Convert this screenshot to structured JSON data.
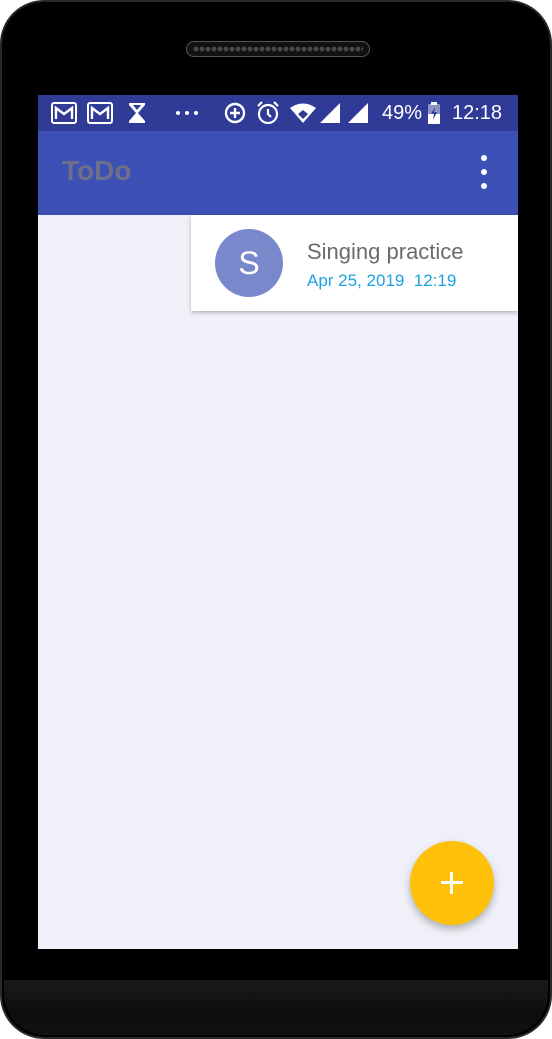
{
  "status_bar": {
    "icons": [
      "gmail-icon",
      "gmail-icon",
      "hourglass-icon",
      "more-notifications-icon",
      "data-saver-icon",
      "alarm-icon",
      "wifi-icon",
      "cell-signal-icon",
      "cell-signal-icon",
      "battery-icon"
    ],
    "battery": "49%",
    "time": "12:18",
    "background": "#2f3b96"
  },
  "app_bar": {
    "title": "ToDo",
    "menu_icon": "more-vert-icon",
    "background": "#3d50b5"
  },
  "todo_list": [
    {
      "avatar_letter": "S",
      "title": "Singing practice",
      "datetime": "Apr 25, 2019  12:19",
      "avatar_color": "#7987cb"
    }
  ],
  "fab": {
    "icon": "add-icon",
    "color": "#fec009"
  },
  "colors": {
    "screen_background": "#eff0f8",
    "datetime_text": "#1aa3e0"
  }
}
